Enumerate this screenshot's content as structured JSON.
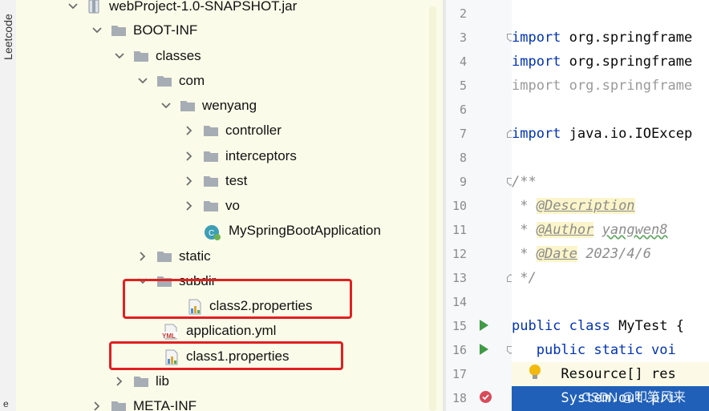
{
  "sidebar": {
    "label": "Leetcode",
    "bottom_glyph": "e"
  },
  "tree": {
    "rows": [
      {
        "label": "webProject-1.0-SNAPSHOT.jar",
        "icon": "jar-icon"
      },
      {
        "label": "BOOT-INF",
        "icon": "folder-icon"
      },
      {
        "label": "classes",
        "icon": "folder-icon"
      },
      {
        "label": "com",
        "icon": "folder-icon"
      },
      {
        "label": "wenyang",
        "icon": "folder-icon"
      },
      {
        "label": "controller",
        "icon": "folder-icon"
      },
      {
        "label": "interceptors",
        "icon": "folder-icon"
      },
      {
        "label": "test",
        "icon": "folder-icon"
      },
      {
        "label": "vo",
        "icon": "folder-icon"
      },
      {
        "label": "MySpringBootApplication",
        "icon": "spring-class-icon"
      },
      {
        "label": "static",
        "icon": "folder-icon"
      },
      {
        "label": "subdir",
        "icon": "folder-icon"
      },
      {
        "label": "class2.properties",
        "icon": "properties-file-icon"
      },
      {
        "label": "application.yml",
        "icon": "yaml-file-icon"
      },
      {
        "label": "class1.properties",
        "icon": "properties-file-icon"
      },
      {
        "label": "lib",
        "icon": "folder-icon"
      },
      {
        "label": "META-INF",
        "icon": "folder-icon"
      }
    ]
  },
  "editor": {
    "line_numbers": [
      "2",
      "3",
      "4",
      "5",
      "6",
      "7",
      "8",
      "9",
      "10",
      "11",
      "12",
      "13",
      "14",
      "15",
      "16",
      "17",
      "18"
    ],
    "code": {
      "l3_kw": "import",
      "l3_rest": " org.springframe",
      "l4_kw": "import",
      "l4_rest": " org.springframe",
      "l5": "import org.springframe",
      "l7_kw": "import",
      "l7_rest": " java.io.IOExcep",
      "l9": "/**",
      "l10_pre": " * ",
      "l10_tag": "@Description",
      "l11_pre": " * ",
      "l11_tag": "@Author",
      "l11_sp": " ",
      "l11_val": "yangwen8",
      "l12_pre": " * ",
      "l12_tag": "@Date",
      "l12_val": " 2023/4/6",
      "l13": " */",
      "l15_kw": "public class",
      "l15_rest": " MyTest {",
      "l16_ind": "   ",
      "l16_kw": "public static",
      "l16_rest": " voi",
      "l17": "      Resource[] res",
      "l18": "      System.out.pri"
    },
    "watermark": "CSDN @叩笑风来"
  },
  "colors": {
    "keyword": "#0033b3",
    "comment": "#8c8c8c",
    "selection": "#2060b8",
    "tree_bg": "#fbfbe9",
    "highlight_box": "#e02020"
  }
}
